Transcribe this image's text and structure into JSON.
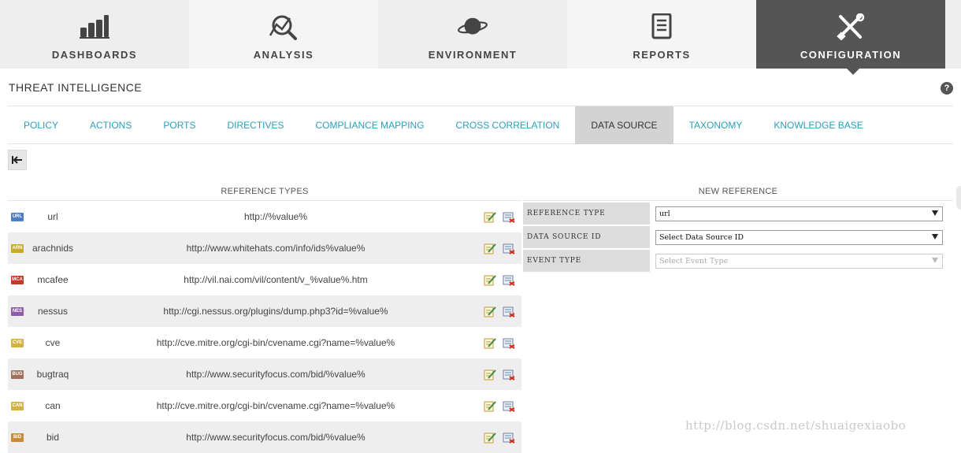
{
  "topnav": {
    "items": [
      {
        "label": "DASHBOARDS",
        "icon": "bar-chart-icon"
      },
      {
        "label": "ANALYSIS",
        "icon": "magnifier-chart-icon"
      },
      {
        "label": "ENVIRONMENT",
        "icon": "planet-icon"
      },
      {
        "label": "REPORTS",
        "icon": "document-icon"
      },
      {
        "label": "CONFIGURATION",
        "icon": "tools-icon",
        "active": true
      }
    ]
  },
  "section": {
    "title": "THREAT INTELLIGENCE",
    "help": "?"
  },
  "subtabs": [
    {
      "label": "POLICY"
    },
    {
      "label": "ACTIONS"
    },
    {
      "label": "PORTS"
    },
    {
      "label": "DIRECTIVES"
    },
    {
      "label": "COMPLIANCE MAPPING"
    },
    {
      "label": "CROSS CORRELATION"
    },
    {
      "label": "DATA SOURCE",
      "active": true
    },
    {
      "label": "TAXONOMY"
    },
    {
      "label": "KNOWLEDGE BASE"
    }
  ],
  "reference_types": {
    "header": "REFERENCE TYPES",
    "rows": [
      {
        "badge": "URL",
        "badge_color": "#4a7fc1",
        "name": "url",
        "url": "http://%value%"
      },
      {
        "badge": "ARN",
        "badge_color": "#c9a92c",
        "name": "arachnids",
        "url": "http://www.whitehats.com/info/ids%value%"
      },
      {
        "badge": "MCA",
        "badge_color": "#c0392b",
        "name": "mcafee",
        "url": "http://vil.nai.com/vil/content/v_%value%.htm"
      },
      {
        "badge": "NES",
        "badge_color": "#8e5ba8",
        "name": "nessus",
        "url": "http://cgi.nessus.org/plugins/dump.php3?id=%value%"
      },
      {
        "badge": "CVE",
        "badge_color": "#d4b04a",
        "name": "cve",
        "url": "http://cve.mitre.org/cgi-bin/cvename.cgi?name=%value%"
      },
      {
        "badge": "BUG",
        "badge_color": "#a0705a",
        "name": "bugtraq",
        "url": "http://www.securityfocus.com/bid/%value%"
      },
      {
        "badge": "CAN",
        "badge_color": "#d4b04a",
        "name": "can",
        "url": "http://cve.mitre.org/cgi-bin/cvename.cgi?name=%value%"
      },
      {
        "badge": "BID",
        "badge_color": "#c98a3a",
        "name": "bid",
        "url": "http://www.securityfocus.com/bid/%value%"
      }
    ]
  },
  "new_reference": {
    "header": "NEW REFERENCE",
    "fields": [
      {
        "label": "REFERENCE TYPE",
        "value": "url",
        "disabled": false
      },
      {
        "label": "DATA SOURCE ID",
        "value": "Select Data Source ID",
        "disabled": false
      },
      {
        "label": "EVENT TYPE",
        "value": "Select Event Type",
        "disabled": true
      }
    ]
  },
  "watermark": "http://blog.csdn.net/shuaigexiaobo"
}
